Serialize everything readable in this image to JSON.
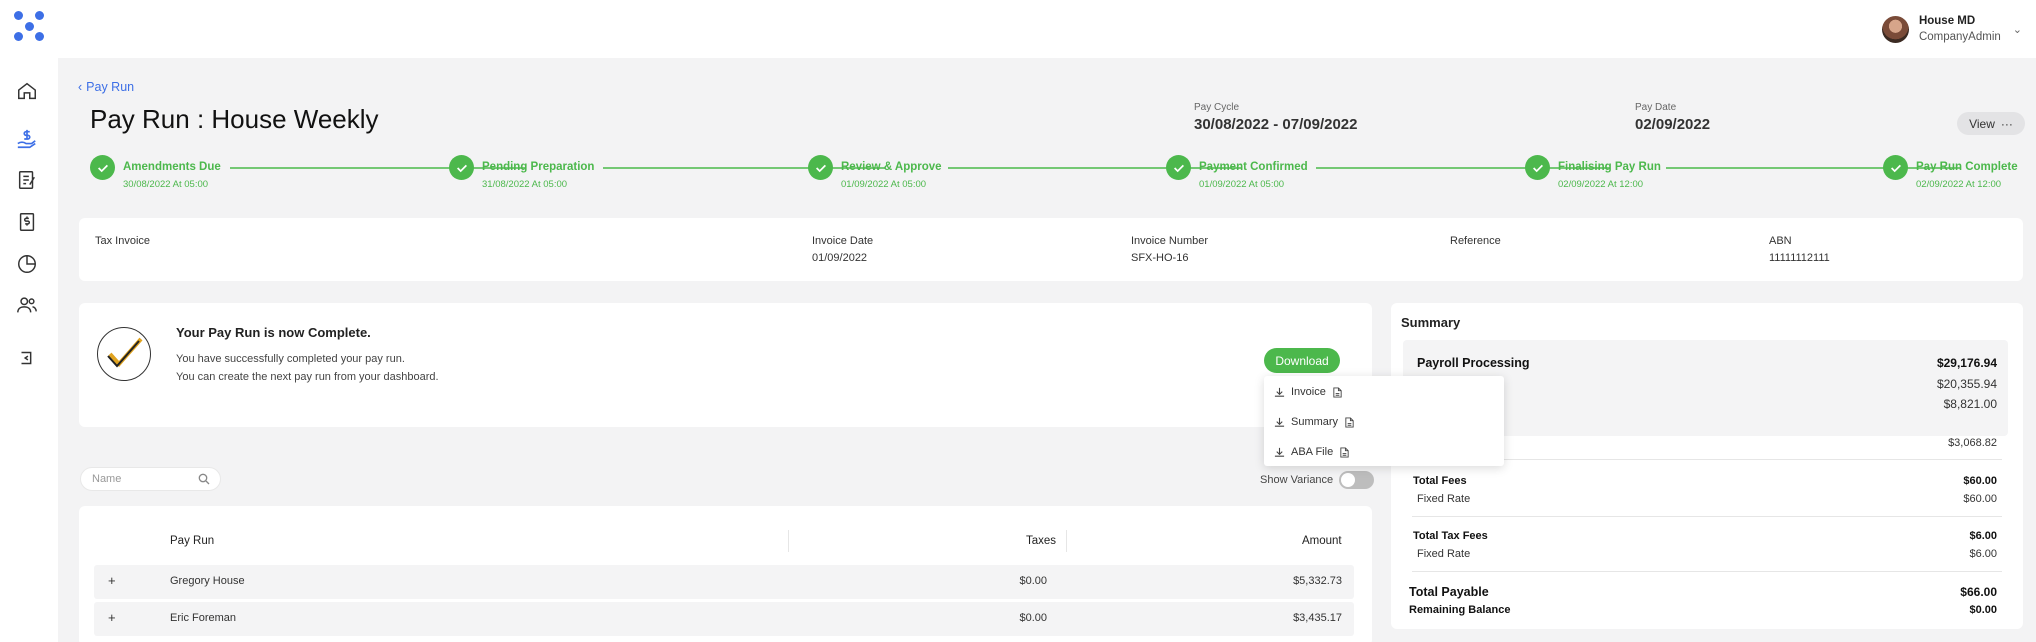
{
  "app": {
    "logo_icon": "app-logo-dots",
    "accent": "#3d6fe6",
    "success": "#4cb84c"
  },
  "user": {
    "name": "House MD",
    "role": "CompanyAdmin"
  },
  "sidebar": {
    "items": [
      "home-icon",
      "pay-run-icon",
      "documents-icon",
      "billing-icon",
      "reports-icon",
      "people-icon",
      "logout-icon"
    ]
  },
  "header": {
    "back_label": "Pay Run",
    "title": "Pay Run : House Weekly",
    "pay_cycle_label": "Pay Cycle",
    "pay_cycle_value": "30/08/2022 - 07/09/2022",
    "pay_date_label": "Pay Date",
    "pay_date_value": "02/09/2022",
    "view_label": "View"
  },
  "steps": [
    {
      "label": "Amendments Due",
      "date": "30/08/2022 At 05:00"
    },
    {
      "label": "Pending Preparation",
      "date": "31/08/2022 At 05:00"
    },
    {
      "label": "Review & Approve",
      "date": "01/09/2022 At 05:00"
    },
    {
      "label": "Payment Confirmed",
      "date": "01/09/2022 At 05:00"
    },
    {
      "label": "Finalising Pay Run",
      "date": "02/09/2022 At 12:00"
    },
    {
      "label": "Pay Run Complete",
      "date": "02/09/2022 At 12:00"
    }
  ],
  "invoice": {
    "tax_invoice_label": "Tax Invoice",
    "date_label": "Invoice Date",
    "date_value": "01/09/2022",
    "number_label": "Invoice Number",
    "number_value": "SFX-HO-16",
    "reference_label": "Reference",
    "abn_label": "ABN",
    "abn_value": "11111112111"
  },
  "complete": {
    "title": "Your Pay Run is now Complete.",
    "line1": "You have successfully completed your pay run.",
    "line2": "You can create the next pay run from your dashboard.",
    "download_label": "Download",
    "download_options": [
      "Invoice",
      "Summary",
      "ABA File"
    ]
  },
  "search": {
    "placeholder": "Name"
  },
  "variance": {
    "label": "Show Variance",
    "enabled": false
  },
  "table": {
    "columns": [
      "Pay Run",
      "Taxes",
      "Amount"
    ],
    "rows": [
      {
        "expand": "+",
        "name": "Gregory House",
        "taxes": "$0.00",
        "amount": "$5,332.73"
      },
      {
        "expand": "+",
        "name": "Eric Foreman",
        "taxes": "$0.00",
        "amount": "$3,435.17"
      }
    ]
  },
  "summary": {
    "title": "Summary",
    "payroll_label": "Payroll Processing",
    "payroll_total": "$29,176.94",
    "payroll_line2": "$20,355.94",
    "payroll_line3": "$8,821.00",
    "payroll_line4": "$3,068.82",
    "total_fees_label": "Total Fees",
    "total_fees_value": "$60.00",
    "fees_fixed_label": "Fixed Rate",
    "fees_fixed_value": "$60.00",
    "total_tax_fees_label": "Total Tax Fees",
    "total_tax_fees_value": "$6.00",
    "tax_fixed_label": "Fixed Rate",
    "tax_fixed_value": "$6.00",
    "total_payable_label": "Total Payable",
    "total_payable_value": "$66.00",
    "remaining_label": "Remaining Balance",
    "remaining_value": "$0.00"
  }
}
